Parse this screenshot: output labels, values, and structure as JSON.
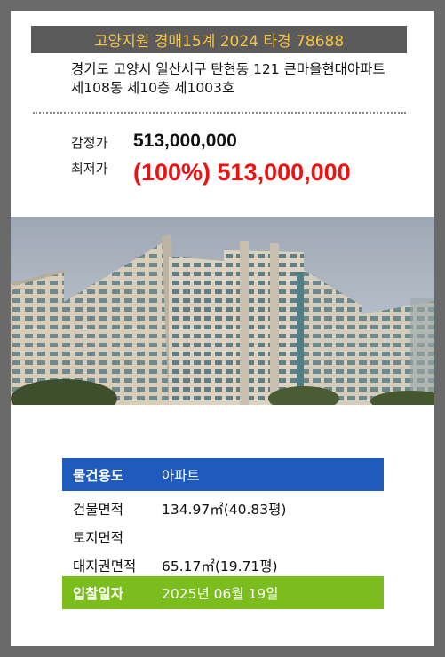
{
  "header": {
    "title": "고양지원 경매15계 2024 타경 78688"
  },
  "address": {
    "line1": "경기도 고양시 일산서구 탄현동 121 큰마을현대아파트",
    "line2": "제108동 제10층 제1003호"
  },
  "prices": {
    "appraisal_label": "감정가",
    "appraisal_value": "513,000,000",
    "minimum_label": "최저가",
    "minimum_value": "(100%) 513,000,000"
  },
  "photo": {
    "subject": "apartment-building-photo"
  },
  "info": {
    "rows": [
      {
        "key": "물건용도",
        "value": "아파트"
      },
      {
        "key": "건물면적",
        "value": "134.97㎡(40.83평)"
      },
      {
        "key": "토지면적",
        "value": ""
      },
      {
        "key": "대지권면적",
        "value": "65.17㎡(19.71평)"
      },
      {
        "key": "입찰일자",
        "value": "2025년 06월 19일"
      }
    ]
  },
  "colors": {
    "header_bg": "#5b5b5b",
    "header_text": "#f5c542",
    "minimum_price": "#ee1111",
    "row_blue": "#1f5bbd",
    "row_green": "#7cbd1e"
  }
}
